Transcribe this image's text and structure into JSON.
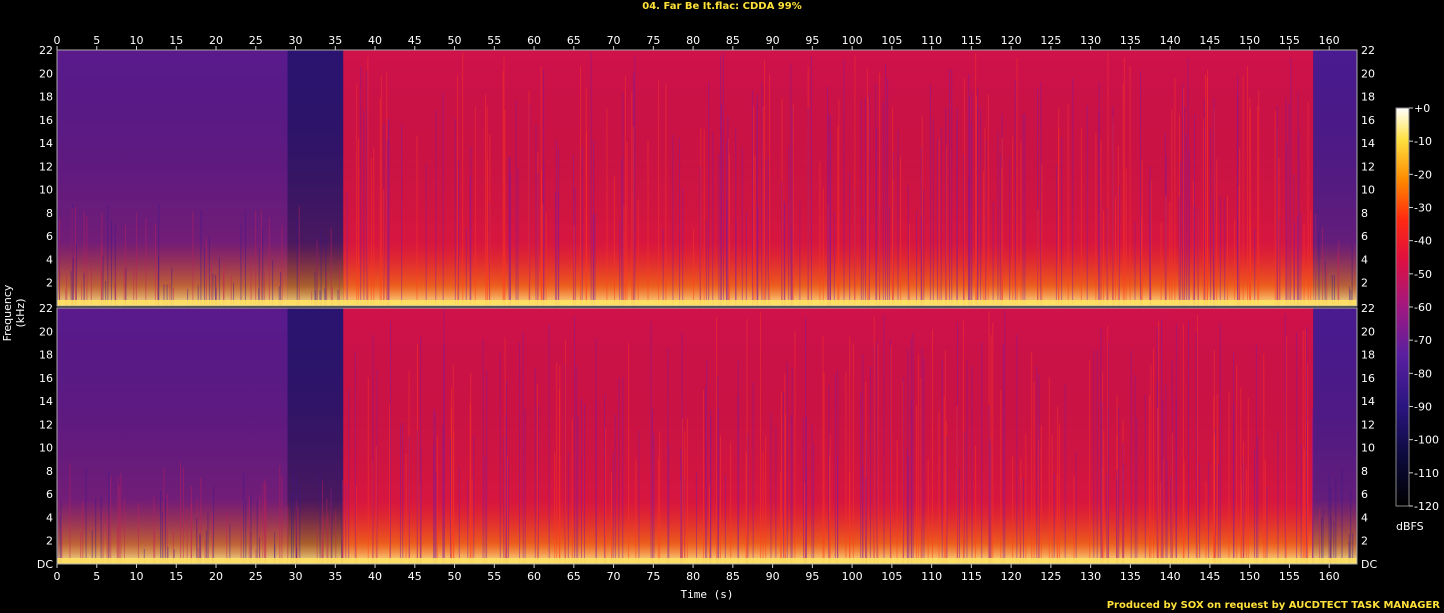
{
  "title": "04. Far Be It.flac: CDDA 99%",
  "credit": "Produced by SOX on request by AUCDTECT TASK MANAGER",
  "chart_data": {
    "type": "heatmap",
    "title": "04. Far Be It.flac: CDDA 99%",
    "xlabel": "Time (s)",
    "ylabel": "Frequency (kHz)",
    "xlim": [
      0,
      163.5
    ],
    "ylim": [
      0,
      22
    ],
    "x_ticks": [
      0,
      5,
      10,
      15,
      20,
      25,
      30,
      35,
      40,
      45,
      50,
      55,
      60,
      65,
      70,
      75,
      80,
      85,
      90,
      95,
      100,
      105,
      110,
      115,
      120,
      125,
      130,
      135,
      140,
      145,
      150,
      155,
      160
    ],
    "y_ticks_top": [
      "2",
      "4",
      "6",
      "8",
      "10",
      "12",
      "14",
      "16",
      "18",
      "20",
      "22"
    ],
    "y_ticks_bottom": [
      "DC",
      "2",
      "4",
      "6",
      "8",
      "10",
      "12",
      "14",
      "16",
      "18",
      "20",
      "22"
    ],
    "channels": 2,
    "colorbar": {
      "label": "dBFS",
      "ticks": [
        "+0",
        "-10",
        "-20",
        "-30",
        "-40",
        "-50",
        "-60",
        "-70",
        "-80",
        "-90",
        "-100",
        "-110",
        "-120"
      ],
      "range": [
        -120,
        0
      ]
    },
    "segments": [
      {
        "start": 0,
        "end": 29,
        "level": "quiet intro, purple"
      },
      {
        "start": 29,
        "end": 36,
        "level": "very quiet, dark blue"
      },
      {
        "start": 36,
        "end": 158,
        "level": "loud, red full-band"
      },
      {
        "start": 158,
        "end": 163.5,
        "level": "fade out, purple"
      }
    ],
    "grid": false
  }
}
